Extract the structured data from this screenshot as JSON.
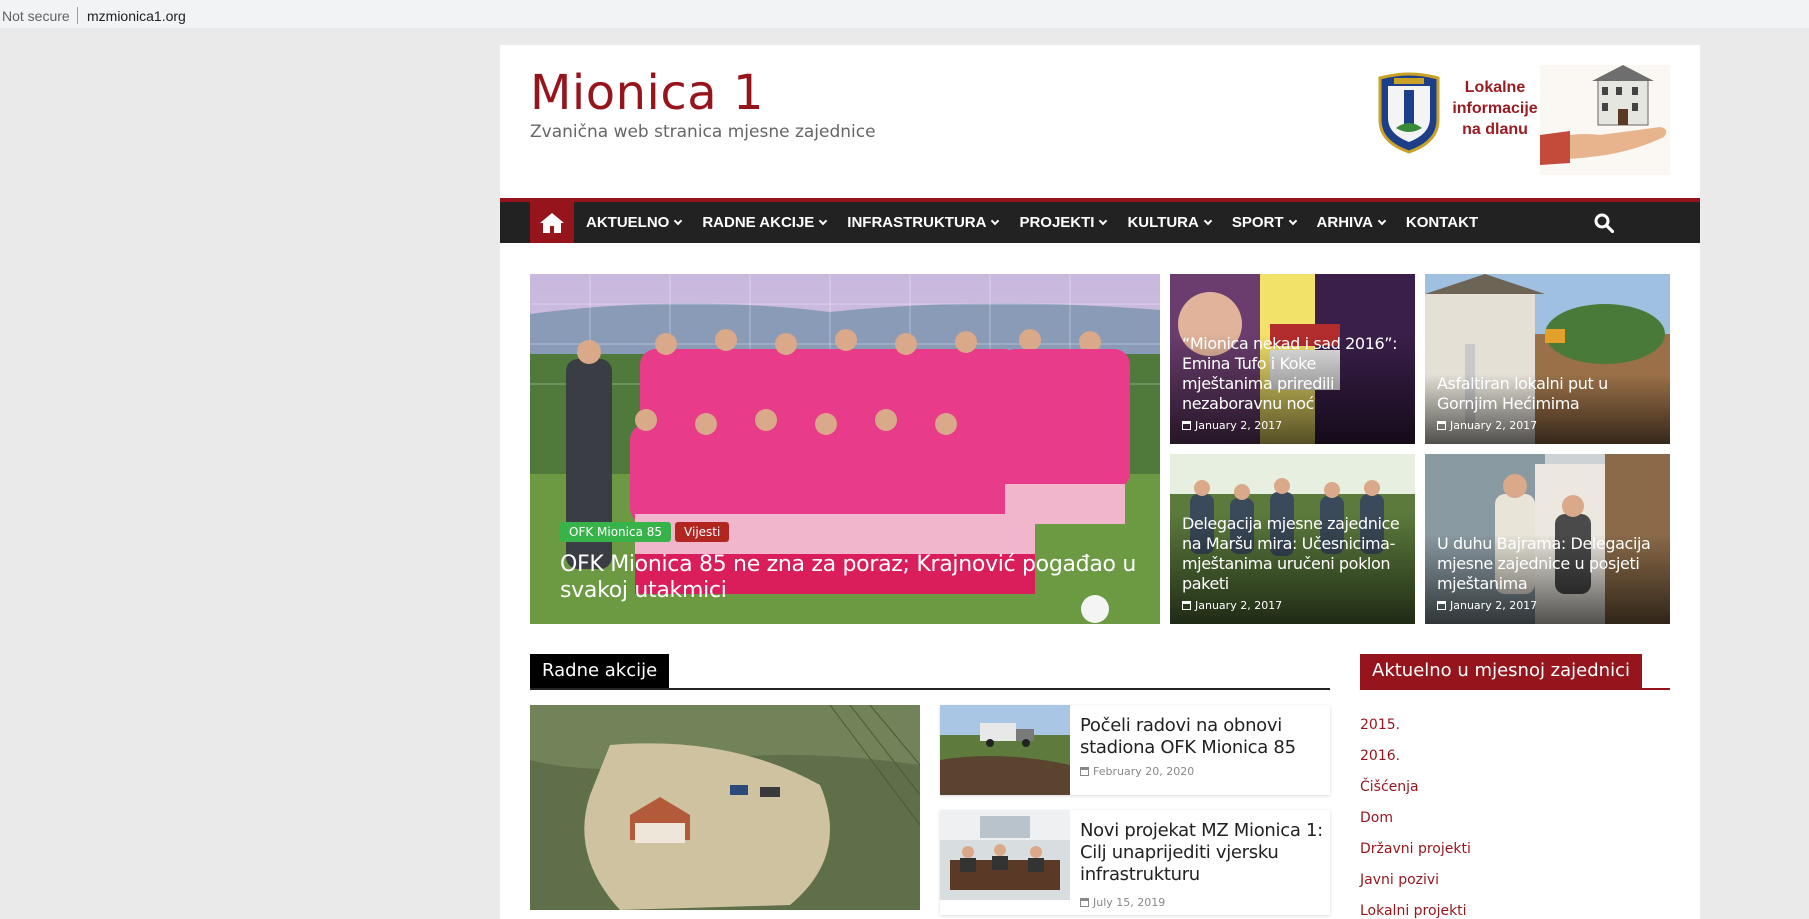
{
  "browser": {
    "security_label": "Not secure",
    "url": "mzmionica1.org"
  },
  "site": {
    "title": "Mionica 1",
    "description": "Zvanična web stranica mjesne zajednice",
    "banner_text": "Lokalne informacije na dlanu",
    "accent_color": "#96151c"
  },
  "nav": {
    "home_icon": "home-icon",
    "items": [
      {
        "label": "AKTUELNO",
        "dropdown": true
      },
      {
        "label": "RADNE AKCIJE",
        "dropdown": true
      },
      {
        "label": "INFRASTRUKTURA",
        "dropdown": true
      },
      {
        "label": "PROJEKTI",
        "dropdown": true
      },
      {
        "label": "KULTURA",
        "dropdown": true
      },
      {
        "label": "SPORT",
        "dropdown": true
      },
      {
        "label": "ARHIVA",
        "dropdown": true
      },
      {
        "label": "KONTAKT",
        "dropdown": false
      }
    ],
    "search_icon": "search-icon"
  },
  "featured": {
    "tags": [
      "OFK Mionica 85",
      "Vijesti"
    ],
    "title": "OFK Mionica 85 ne zna za poraz; Krajnović pogađao u svakoj utakmici"
  },
  "side_posts": [
    {
      "title": "“Mionica nekad i sad 2016”: Emina Tufo i Koke mještanima priredili nezaboravnu noć",
      "date": "January 2, 2017"
    },
    {
      "title": "Asfaltiran lokalni put u Gornjim Hećimima",
      "date": "January 2, 2017"
    },
    {
      "title": "Delegacija mjesne zajednice na Maršu mira: Učesnicima-mještanima uručeni poklon paketi",
      "date": "January 2, 2017"
    },
    {
      "title": "U duhu Bajrama: Delegacija mjesne zajednice u posjeti mještanima",
      "date": "January 2, 2017"
    }
  ],
  "radne_akcije": {
    "heading": "Radne akcije",
    "posts": [
      {
        "title": "Počeli radovi na obnovi stadiona OFK Mionica 85",
        "date": "February 20, 2020"
      },
      {
        "title": "Novi projekat MZ Mionica 1: Cilj unaprijediti vjersku infrastrukturu",
        "date": "July 15, 2019"
      }
    ]
  },
  "sidebar": {
    "heading": "Aktuelno u mjesnoj zajednici",
    "categories": [
      "2015.",
      "2016.",
      "Čišćenja",
      "Dom",
      "Državni projekti",
      "Javni pozivi",
      "Lokalni projekti"
    ]
  }
}
